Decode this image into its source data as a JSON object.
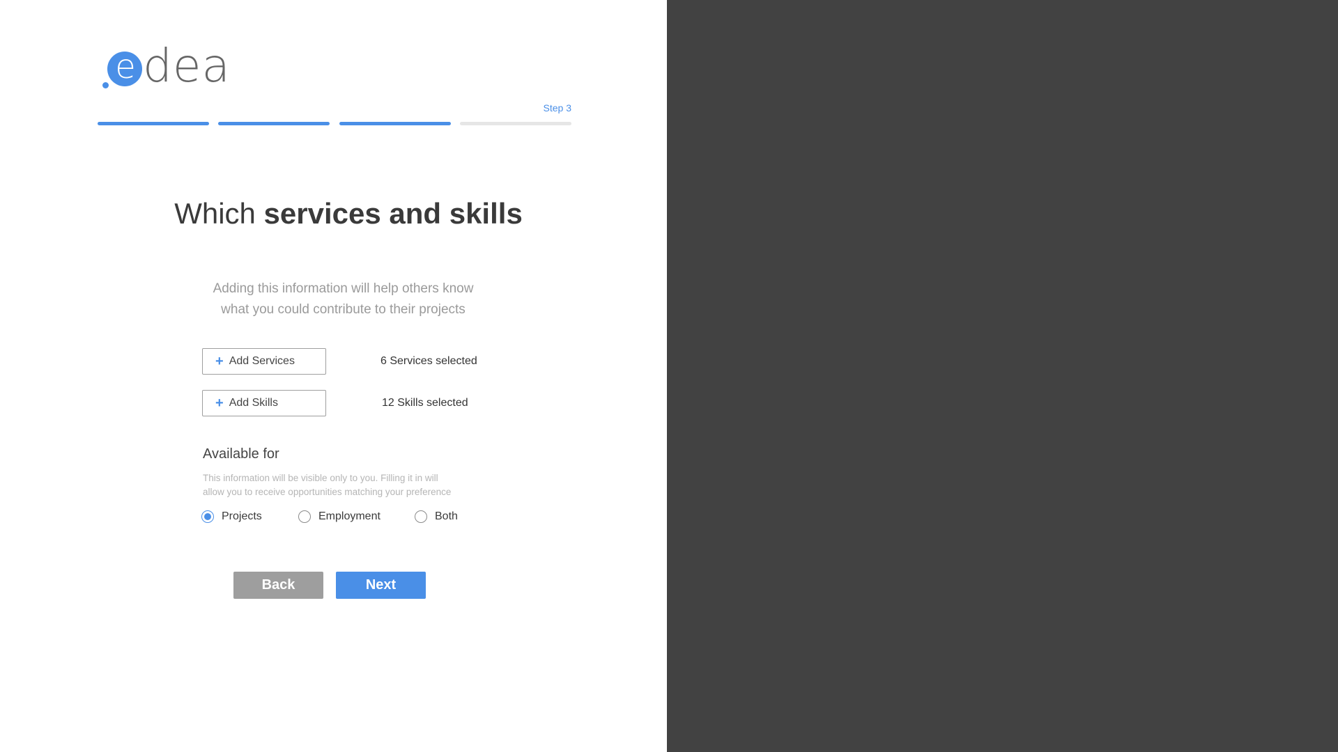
{
  "brand": {
    "logo_first_letter": "e",
    "logo_rest": "dea",
    "accent_color": "#4a8fe7"
  },
  "progress": {
    "step_label": "Step 3",
    "current_step": 3,
    "total_steps": 4
  },
  "heading": {
    "light": "Which ",
    "bold": "services and skills"
  },
  "subtitle": {
    "line1": "Adding this information will help others know",
    "line2": "what you could contribute to their projects"
  },
  "services": {
    "button_label": "Add Services",
    "selected_text": "6 Services selected"
  },
  "skills": {
    "button_label": "Add Skills",
    "selected_text": "12 Skills selected"
  },
  "availability": {
    "title": "Available for",
    "note_line1": "This information will be visible only to you. Filling it in will",
    "note_line2": "allow you to receive opportunities matching your preference",
    "options": [
      "Projects",
      "Employment",
      "Both"
    ],
    "selected": "Projects"
  },
  "actions": {
    "back_label": "Back",
    "next_label": "Next"
  },
  "colors": {
    "right_panel": "#424242",
    "back_button": "#9e9e9e",
    "inactive_progress": "#e6e6e6"
  }
}
